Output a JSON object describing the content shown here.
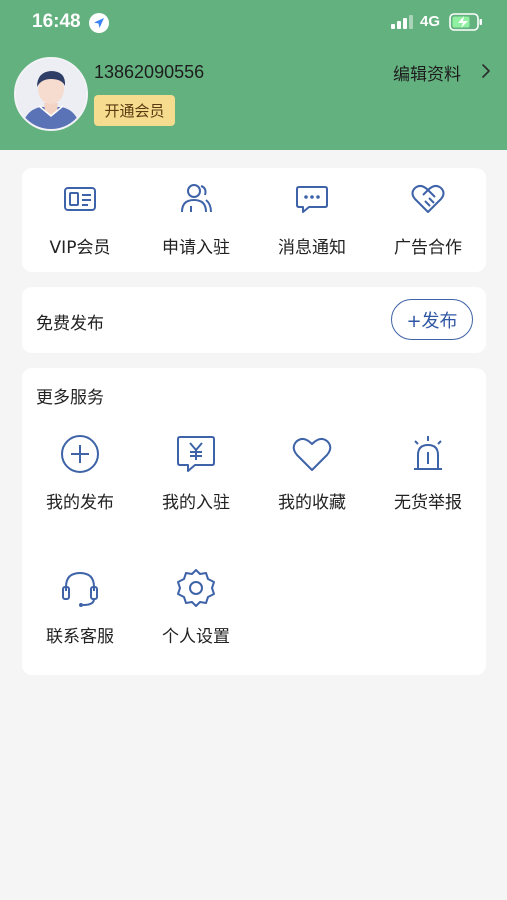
{
  "status_bar": {
    "time": "16:48",
    "network": "4G"
  },
  "profile": {
    "phone": "13862090556",
    "vip_button": "开通会员",
    "edit_link": "编辑资料"
  },
  "quick_actions": [
    {
      "label": "VIP会员",
      "icon": "member-card-icon"
    },
    {
      "label": "申请入驻",
      "icon": "users-icon"
    },
    {
      "label": "消息通知",
      "icon": "message-icon"
    },
    {
      "label": "广告合作",
      "icon": "handshake-heart-icon"
    }
  ],
  "publish": {
    "label": "免费发布",
    "button": "+发布"
  },
  "more_services": {
    "title": "更多服务",
    "items": [
      {
        "label": "我的发布",
        "icon": "plus-circle-icon"
      },
      {
        "label": "我的入驻",
        "icon": "yen-message-icon"
      },
      {
        "label": "我的收藏",
        "icon": "heart-icon"
      },
      {
        "label": "无货举报",
        "icon": "alarm-light-icon"
      },
      {
        "label": "联系客服",
        "icon": "headset-icon"
      },
      {
        "label": "个人设置",
        "icon": "gear-icon"
      }
    ]
  },
  "colors": {
    "header": "#63b17f",
    "accent": "#3f63a8",
    "vip": "#f5dc8f"
  }
}
